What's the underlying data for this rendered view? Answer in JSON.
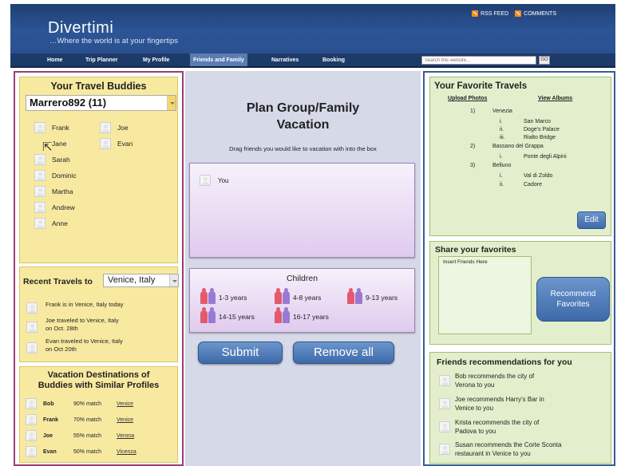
{
  "header": {
    "logo": "Divertimi",
    "tagline": "…Where the world is at your fingertips",
    "rss_label": "RSS FEED",
    "comments_label": "COMMENTS"
  },
  "nav": {
    "items": [
      "Home",
      "Trip Planner",
      "My Profile",
      "Friends and Family",
      "Narratives",
      "Booking"
    ],
    "active": "Friends and Family",
    "search_placeholder": "Search this website...",
    "go_label": "GO"
  },
  "buddies": {
    "title": "Your Travel Buddies",
    "selected_user": "Marrero892 (11)",
    "left_names": [
      "Frank",
      "Jane",
      "Sarah",
      "Dominic",
      "Martha",
      "Andrew",
      "Anne"
    ],
    "right_names": [
      "Joe",
      "Evan"
    ]
  },
  "recent": {
    "label": "Recent Travels to",
    "location": "Venice, Italy",
    "items": [
      [
        "Frank is in Venice, Italy today"
      ],
      [
        "Joe traveled to Venice, Italy",
        "on Oct. 28th"
      ],
      [
        "Evan traveled to Venice, Italy",
        "on Oct 20th"
      ]
    ]
  },
  "vacation": {
    "title_line1": "Vacation Destinations of",
    "title_line2": "Buddies with Similar Profiles",
    "rows": [
      {
        "name": "Bob",
        "match": "90% match",
        "city": "Venice"
      },
      {
        "name": "Frank",
        "match": "70% match",
        "city": "Venice"
      },
      {
        "name": "Joe",
        "match": "55% match",
        "city": "Verona"
      },
      {
        "name": "Evan",
        "match": "50% match",
        "city": "Vicenza"
      }
    ]
  },
  "plan": {
    "title_line1": "Plan Group/Family",
    "title_line2": "Vacation",
    "subtitle": "Drag friends you would like to vacation with into the box",
    "you_label": "You",
    "children_title": "Children",
    "age_groups": [
      "1-3 years",
      "4-8 years",
      "9-13 years",
      "14-15 years",
      "16-17 years"
    ],
    "submit_label": "Submit",
    "remove_label": "Remove all"
  },
  "favorites": {
    "title": "Your Favorite Travels",
    "upload_label": "Upload Photos",
    "albums_label": "View Albums",
    "tree": [
      {
        "num": "1)",
        "city": "Venezia",
        "subs": [
          [
            "i.",
            "San Marco"
          ],
          [
            "ii.",
            "Doge's Palace"
          ],
          [
            "iii.",
            "Rialto Bridge"
          ]
        ]
      },
      {
        "num": "2)",
        "city": "Bassano del Grappa",
        "subs": [
          [
            "i.",
            "Ponte degli Alpini"
          ]
        ]
      },
      {
        "num": "3)",
        "city": "Belluno",
        "subs": [
          [
            "i.",
            "Val di Zoldo"
          ],
          [
            "ii.",
            "Cadore"
          ]
        ]
      }
    ],
    "edit_label": "Edit"
  },
  "share": {
    "title": "Share your favorites",
    "insert_label": "Insert Friends Here",
    "recommend_line1": "Recommend",
    "recommend_line2": "Favorites"
  },
  "friends_recs": {
    "title": "Friends recommendations for you",
    "items": [
      [
        "Bob recommends  the city of",
        "Verona to you"
      ],
      [
        "Joe recommends Harry's Bar in",
        "Venice to you"
      ],
      [
        "Krista recommends  the city of",
        "Padova to you"
      ],
      [
        "Susan recommends  the Corte Sconta",
        "restaurant in Venice to you"
      ]
    ]
  }
}
